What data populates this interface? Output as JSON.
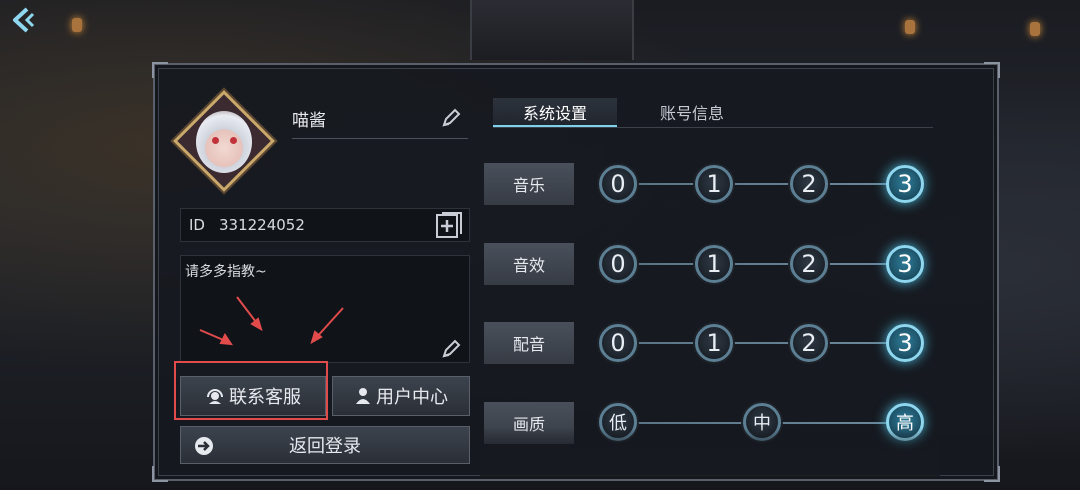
{
  "header": {
    "back_icon": "back-arrow-icon"
  },
  "profile": {
    "name": "喵酱",
    "id_label": "ID",
    "id_value": "331224052",
    "bio": "请多多指教~"
  },
  "buttons": {
    "customer_service": "联系客服",
    "user_center": "用户中心",
    "back_to_login": "返回登录"
  },
  "tabs": [
    {
      "label": "系统设置",
      "active": true
    },
    {
      "label": "账号信息",
      "active": false
    }
  ],
  "settings": [
    {
      "label": "音乐",
      "options": [
        "0",
        "1",
        "2",
        "3"
      ],
      "selected": "3"
    },
    {
      "label": "音效",
      "options": [
        "0",
        "1",
        "2",
        "3"
      ],
      "selected": "3"
    },
    {
      "label": "配音",
      "options": [
        "0",
        "1",
        "2",
        "3"
      ],
      "selected": "3"
    },
    {
      "label": "画质",
      "options": [
        "低",
        "中",
        "高"
      ],
      "selected": "高"
    }
  ],
  "colors": {
    "accent": "#7fd0ea",
    "highlight_box": "#e24b4b",
    "arrow": "#e24b4b"
  }
}
